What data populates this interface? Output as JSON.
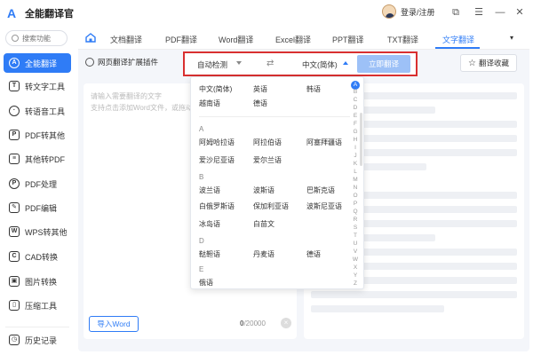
{
  "app": {
    "title": "全能翻译官"
  },
  "header": {
    "login": "登录/注册"
  },
  "window": {
    "maximize_icon": "maximize-icon",
    "menu_icon": "menu-icon",
    "minimize_icon": "minimize-icon",
    "close_icon": "close-icon"
  },
  "sidebar": {
    "search_placeholder": "搜索功能",
    "items": [
      {
        "label": "全能翻译",
        "icon": "translate-icon",
        "active": true
      },
      {
        "label": "转文字工具",
        "icon": "text-icon"
      },
      {
        "label": "转语音工具",
        "icon": "speech-icon"
      },
      {
        "label": "PDF转其他",
        "icon": "pdf-icon"
      },
      {
        "label": "其他转PDF",
        "icon": "file-icon"
      },
      {
        "label": "PDF处理",
        "icon": "pdf-process-icon"
      },
      {
        "label": "PDF编辑",
        "icon": "pdf-edit-icon"
      },
      {
        "label": "WPS转其他",
        "icon": "wps-icon"
      },
      {
        "label": "CAD转换",
        "icon": "cad-icon"
      },
      {
        "label": "图片转换",
        "icon": "image-icon"
      },
      {
        "label": "压缩工具",
        "icon": "compress-icon"
      },
      {
        "label": "历史记录",
        "icon": "history-icon"
      }
    ]
  },
  "tabs": [
    "文档翻译",
    "PDF翻译",
    "Word翻译",
    "Excel翻译",
    "PPT翻译",
    "TXT翻译",
    "文字翻译"
  ],
  "tabs_more": "▾",
  "toolbar": {
    "ext_label": "网页翻译扩展插件",
    "source_lang": "自动检测",
    "swap": "⇄",
    "target_lang": "中文(简体)",
    "translate_btn": "立即翻译",
    "favorites": "翻译收藏",
    "star": "☆"
  },
  "source": {
    "placeholder_line1": "请输入需要翻译的文字",
    "placeholder_line2": "支持点击添加Word文件，或拖动",
    "import_btn": "导入Word",
    "count_current": "0",
    "count_max": "/20000",
    "clear": "×"
  },
  "dropdown": {
    "top_items": [
      "中文(简体)",
      "英语",
      "韩语",
      "越南语",
      "德语"
    ],
    "sections": [
      {
        "letter": "A",
        "items": [
          "阿姆哈拉语",
          "阿拉伯语",
          "阿塞拜疆语",
          "爱沙尼亚语",
          "爱尔兰语"
        ]
      },
      {
        "letter": "B",
        "items": [
          "波兰语",
          "波斯语",
          "巴斯克语",
          "白俄罗斯语",
          "保加利亚语",
          "波斯尼亚语",
          "冰岛语",
          "白苗文"
        ]
      },
      {
        "letter": "D",
        "items": [
          "鞑靼语",
          "丹麦语",
          "德语"
        ]
      },
      {
        "letter": "E",
        "items": [
          "俄语"
        ]
      }
    ],
    "alphabet": [
      "A",
      "B",
      "C",
      "D",
      "E",
      "F",
      "G",
      "H",
      "I",
      "J",
      "K",
      "L",
      "M",
      "N",
      "O",
      "P",
      "Q",
      "R",
      "S",
      "T",
      "U",
      "V",
      "W",
      "X",
      "Y",
      "Z"
    ]
  }
}
